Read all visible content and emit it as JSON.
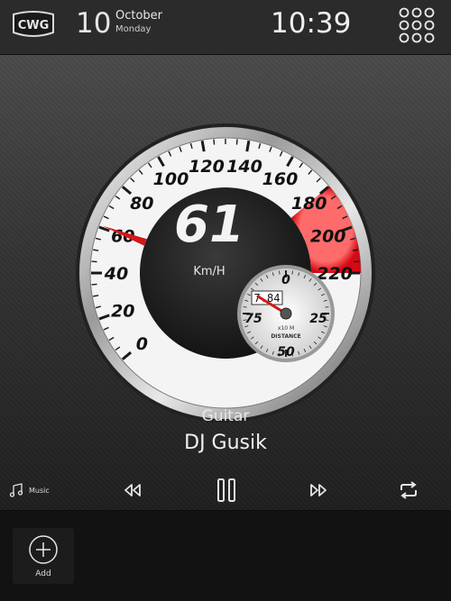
{
  "header": {
    "logo_text": "CWG",
    "day": "10",
    "month": "October",
    "weekday": "Monday",
    "time": "10:39",
    "apps_icon": "grid-dots-icon"
  },
  "gauge": {
    "speed": "61",
    "unit": "Km/H",
    "speed_value": 61,
    "max_speed": 220,
    "labels": [
      "0",
      "20",
      "40",
      "60",
      "80",
      "100",
      "120",
      "140",
      "160",
      "180",
      "200",
      "220"
    ],
    "redzone_start": 180,
    "odometer": {
      "value": "7.84",
      "multiplier": "x10 M",
      "label": "DISTANCE",
      "labels": [
        "0",
        "25",
        "50",
        "75"
      ]
    },
    "colors": {
      "redzone": "#e0101a",
      "needle": "#d21818",
      "face": "#f4f4f4",
      "hub": "#1e1e1e"
    }
  },
  "track": {
    "title": "Guitar",
    "artist": "DJ Gusik"
  },
  "controls": {
    "music_label": "Music",
    "icons": [
      "music-note-icon",
      "rewind-icon",
      "pause-icon",
      "fast-forward-icon",
      "repeat-icon"
    ]
  },
  "dock": {
    "add_label": "Add"
  }
}
